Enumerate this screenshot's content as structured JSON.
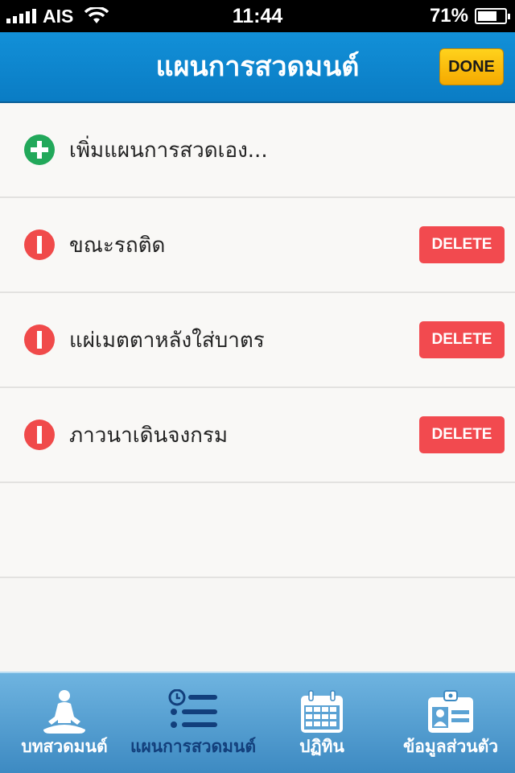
{
  "status_bar": {
    "carrier": "AIS",
    "time": "11:44",
    "battery_percent": "71%",
    "battery_level": 0.71
  },
  "nav": {
    "title": "แผนการสวดมนต์",
    "done_label": "DONE"
  },
  "add_item": {
    "label": "เพิ่มแผนการสวดเอง...",
    "icon": "plus-circle-icon",
    "color": "#22a85a"
  },
  "plans": [
    {
      "label": "ขณะรถติด",
      "delete_label": "DELETE"
    },
    {
      "label": "แผ่เมตตาหลังใส่บาตร",
      "delete_label": "DELETE"
    },
    {
      "label": "ภาวนาเดินจงกรม",
      "delete_label": "DELETE"
    }
  ],
  "tabs": [
    {
      "label": "บทสวดมนต์",
      "icon": "meditation-icon",
      "active": false
    },
    {
      "label": "แผนการสวดมนต์",
      "icon": "clock-list-icon",
      "active": true
    },
    {
      "label": "ปฏิทิน",
      "icon": "calendar-icon",
      "active": false
    },
    {
      "label": "ข้อมูลส่วนตัว",
      "icon": "id-card-icon",
      "active": false
    }
  ],
  "colors": {
    "nav_blue": "#0a7cc4",
    "done_yellow": "#f5a900",
    "delete_red": "#f24a4f",
    "active_tab": "#123f7c"
  }
}
